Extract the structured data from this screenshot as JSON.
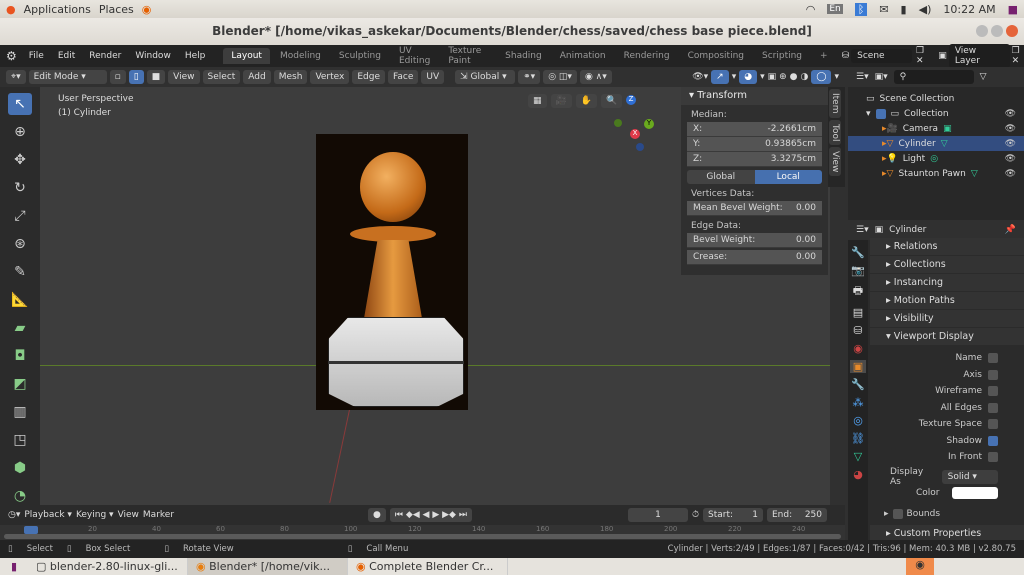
{
  "system": {
    "applications": "Applications",
    "places": "Places",
    "keyboard": "En",
    "clock": "10:22 AM"
  },
  "window": {
    "title": "Blender* [/home/vikas_askekar/Documents/Blender/chess/saved/chess base piece.blend]"
  },
  "topbar": {
    "menus": [
      "File",
      "Edit",
      "Render",
      "Window",
      "Help"
    ],
    "workspaces": [
      "Layout",
      "Modeling",
      "Sculpting",
      "UV Editing",
      "Texture Paint",
      "Shading",
      "Animation",
      "Rendering",
      "Compositing",
      "Scripting"
    ],
    "active_workspace": "Layout",
    "scene": "Scene",
    "view_layer": "View Layer"
  },
  "header": {
    "mode": "Edit Mode",
    "menus": [
      "View",
      "Select",
      "Add",
      "Mesh",
      "Vertex",
      "Edge",
      "Face",
      "UV"
    ],
    "orientation": "Global"
  },
  "viewport": {
    "view_name": "User Perspective",
    "object_info": "(1) Cylinder",
    "gizmo_axes": [
      "X",
      "Y",
      "Z"
    ]
  },
  "npanel": {
    "title": "Transform",
    "median_label": "Median:",
    "rows": [
      {
        "label": "X:",
        "value": "-2.2661cm"
      },
      {
        "label": "Y:",
        "value": "0.93865cm"
      },
      {
        "label": "Z:",
        "value": "3.3275cm"
      }
    ],
    "global": "Global",
    "local": "Local",
    "active_space": "Local",
    "vertices_label": "Vertices Data:",
    "mean_bevel": {
      "label": "Mean Bevel Weight:",
      "value": "0.00"
    },
    "edge_label": "Edge Data:",
    "bevel": {
      "label": "Bevel Weight:",
      "value": "0.00"
    },
    "crease": {
      "label": "Crease:",
      "value": "0.00"
    },
    "tabs": [
      "Item",
      "Tool",
      "View"
    ]
  },
  "outliner": {
    "items": [
      {
        "label": "Scene Collection"
      },
      {
        "label": "Collection"
      },
      {
        "label": "Camera"
      },
      {
        "label": "Cylinder",
        "selected": true
      },
      {
        "label": "Light"
      },
      {
        "label": "Staunton Pawn"
      }
    ]
  },
  "properties": {
    "object": "Cylinder",
    "sections": [
      "Relations",
      "Collections",
      "Instancing",
      "Motion Paths",
      "Visibility",
      "Viewport Display"
    ],
    "display_rows": [
      {
        "label": "Name",
        "checked": false
      },
      {
        "label": "Axis",
        "checked": false
      },
      {
        "label": "Wireframe",
        "checked": false
      },
      {
        "label": "All Edges",
        "checked": false
      },
      {
        "label": "Texture Space",
        "checked": false
      },
      {
        "label": "Shadow",
        "checked": true
      },
      {
        "label": "In Front",
        "checked": false
      }
    ],
    "display_as_label": "Display As",
    "display_as": "Solid",
    "color_label": "Color",
    "bounds": "Bounds",
    "custom": "Custom Properties"
  },
  "timeline": {
    "menus": [
      "Playback",
      "Keying",
      "View",
      "Marker"
    ],
    "frame": "1",
    "start_label": "Start:",
    "start": "1",
    "end_label": "End:",
    "end": "250",
    "ticks": [
      "20",
      "40",
      "60",
      "80",
      "100",
      "120",
      "140",
      "160",
      "180",
      "200",
      "220",
      "240"
    ]
  },
  "status": {
    "select": "Select",
    "box_select": "Box Select",
    "rotate": "Rotate View",
    "call_menu": "Call Menu",
    "info": "Cylinder | Verts:2/49 | Edges:1/87 | Faces:0/42 | Tris:96 | Mem: 40.3 MB | v2.80.75"
  },
  "taskbar": [
    "blender-2.80-linux-gli...",
    "Blender* [/home/vik...",
    "Complete Blender Cr..."
  ],
  "colors": {
    "accent": "#4772b3",
    "selection": "#334d80"
  }
}
